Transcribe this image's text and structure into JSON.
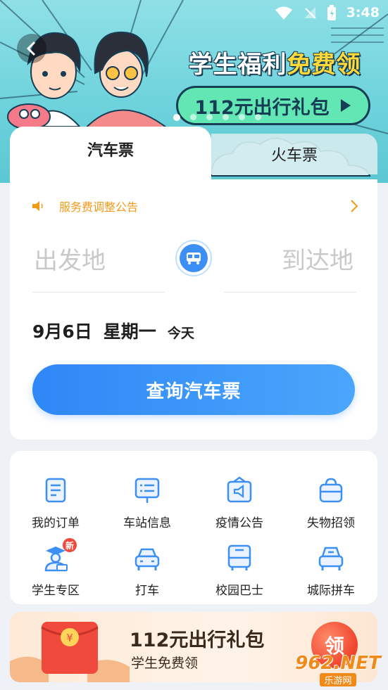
{
  "status_bar": {
    "time": "3:48"
  },
  "banner": {
    "title_part1": "学生福利",
    "title_highlight": "免费领",
    "pill_text": "112元出行礼包",
    "colors": {
      "sky": "#6fd3dc",
      "pill": "#62e7b4",
      "outline": "#163d54"
    }
  },
  "tabs": {
    "bus": "汽车票",
    "train": "火车票"
  },
  "search": {
    "notice": "服务费调整公告",
    "from_placeholder": "出发地",
    "to_placeholder": "到达地",
    "date": "9月6日",
    "weekday": "星期一",
    "today": "今天",
    "query_button": "查询汽车票"
  },
  "services": [
    {
      "label": "我的订单",
      "icon": "order-icon"
    },
    {
      "label": "车站信息",
      "icon": "station-info-icon"
    },
    {
      "label": "疫情公告",
      "icon": "announcement-icon"
    },
    {
      "label": "失物招领",
      "icon": "lost-found-icon"
    },
    {
      "label": "学生专区",
      "icon": "student-icon",
      "badge": "新"
    },
    {
      "label": "打车",
      "icon": "taxi-icon"
    },
    {
      "label": "校园巴士",
      "icon": "campus-bus-icon"
    },
    {
      "label": "城际拼车",
      "icon": "intercity-carpool-icon"
    }
  ],
  "promo": {
    "title": "112元出行礼包",
    "subtitle": "学生免费领",
    "claim_label": "领"
  },
  "watermark": {
    "main": "962.NET",
    "sub": "乐游网"
  },
  "accent_color": "#2f87f7"
}
